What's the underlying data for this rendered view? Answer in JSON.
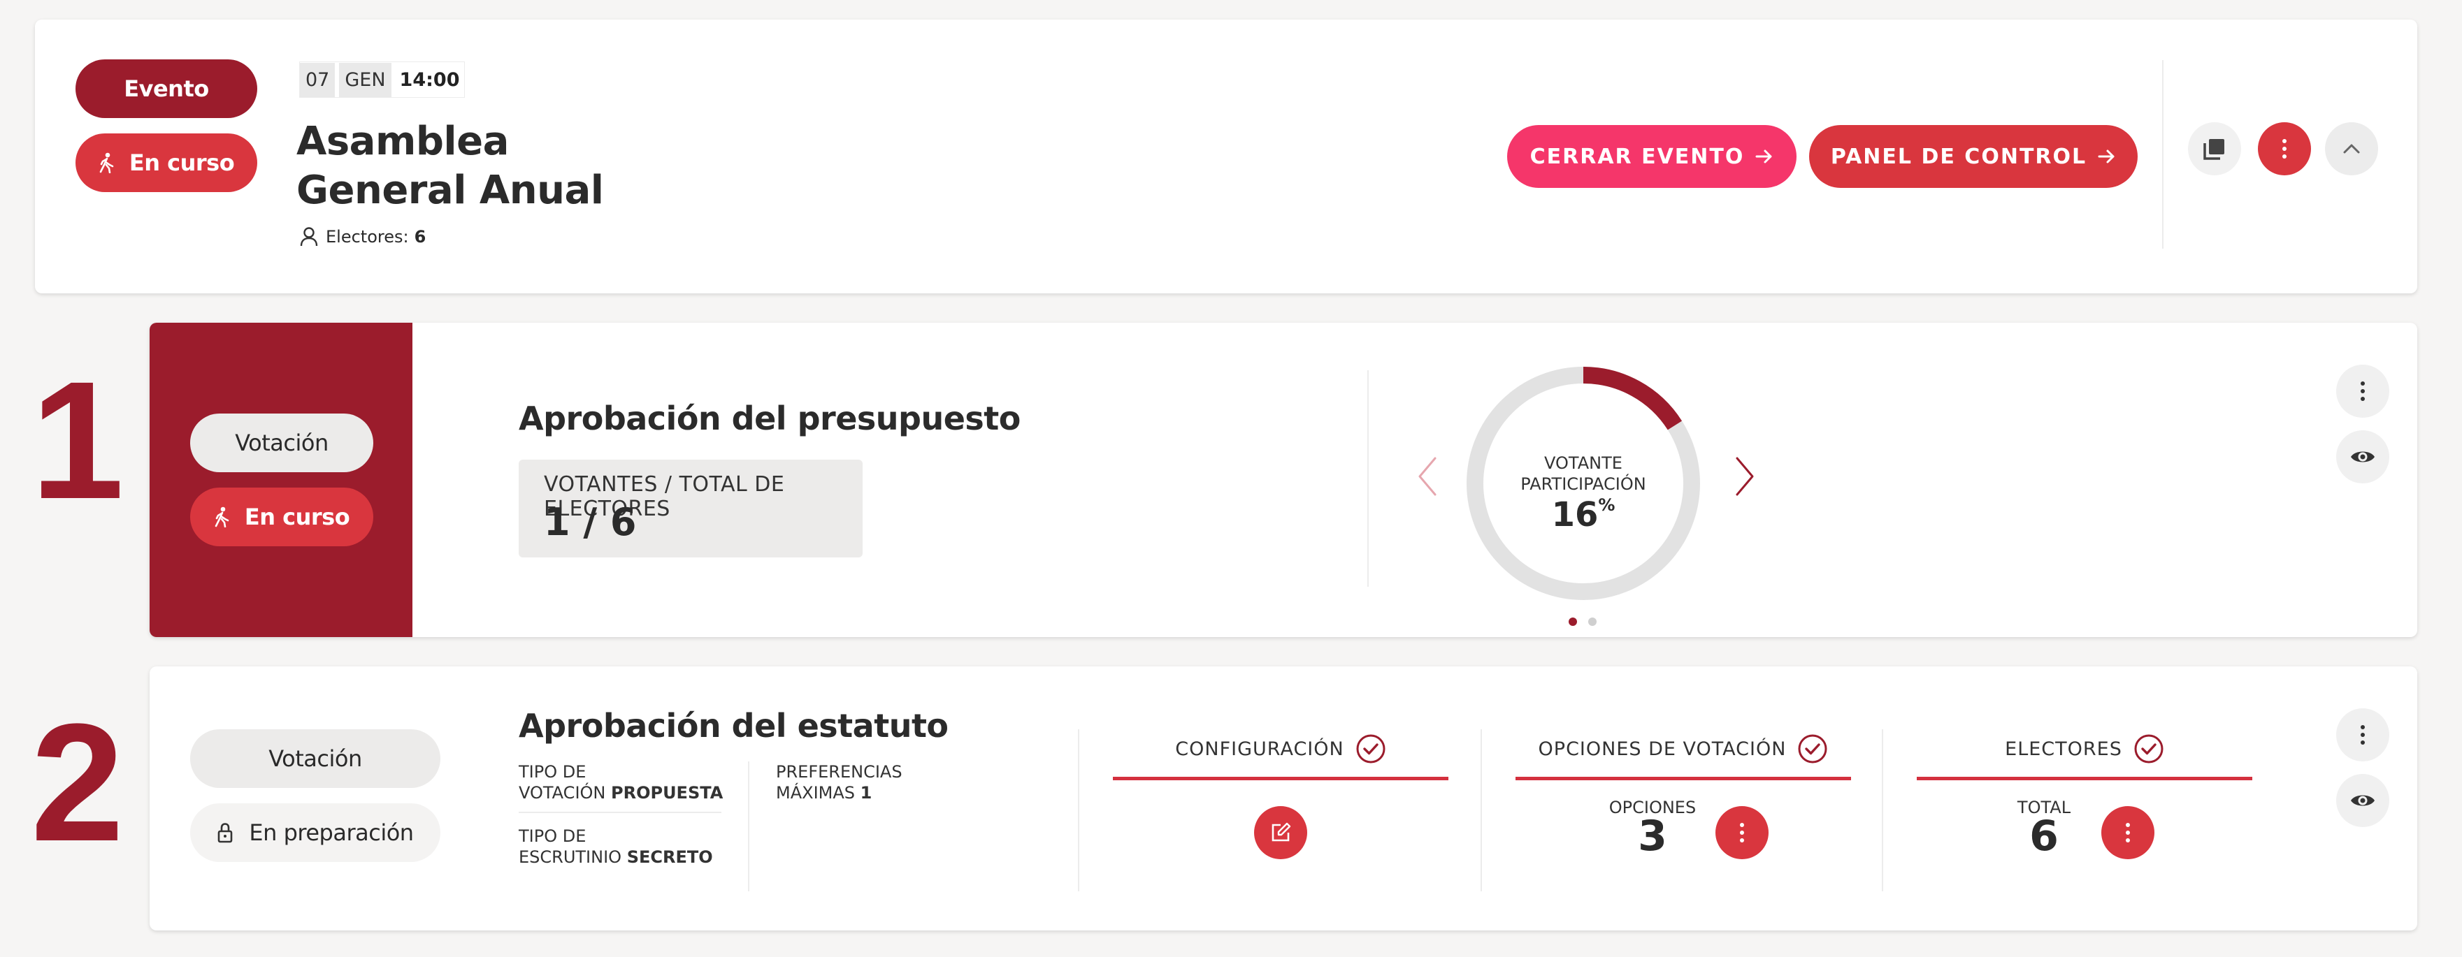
{
  "event": {
    "type_label": "Evento",
    "status_label": "En curso",
    "date": {
      "day": "07",
      "month": "GEN",
      "time": "14:00"
    },
    "title_line1": "Asamblea",
    "title_line2": "General Anual",
    "electors_label": "Electores:",
    "electors_count": "6",
    "close_button": "CERRAR EVENTO",
    "panel_button": "PANEL DE CONTROL"
  },
  "votes": [
    {
      "number": "1",
      "type_label": "Votación",
      "status_label": "En curso",
      "title": "Aprobación del presupuesto",
      "voters_label": "VOTANTES / TOTAL DE ELECTORES",
      "voters_value": "1 / 6",
      "chart_label_line1": "VOTANTE",
      "chart_label_line2": "PARTICIPACIÓN",
      "participation": "16",
      "participation_unit": "%",
      "participation_fraction": 0.16
    },
    {
      "number": "2",
      "type_label": "Votación",
      "status_label": "En preparación",
      "title": "Aprobación del estatuto",
      "vote_type_label_1": "TIPO DE",
      "vote_type_label_2": "VOTACIÓN",
      "vote_type_value": "PROPUESTA",
      "scrutiny_label_1": "TIPO DE",
      "scrutiny_label_2": "ESCRUTINIO",
      "scrutiny_value": "SECRETO",
      "prefs_label_1": "PREFERENCIAS",
      "prefs_label_2": "MÁXIMAS",
      "prefs_value": "1",
      "config_label": "CONFIGURACIÓN",
      "options_label": "OPCIONES DE VOTACIÓN",
      "options_sub": "OPCIONES",
      "options_value": "3",
      "electors_label": "ELECTORES",
      "electors_sub": "TOTAL",
      "electors_value": "6"
    }
  ],
  "colors": {
    "dark_red": "#9b1c2c",
    "red": "#d9363e",
    "pink": "#f5366a",
    "gray_pill": "#ecebea"
  }
}
